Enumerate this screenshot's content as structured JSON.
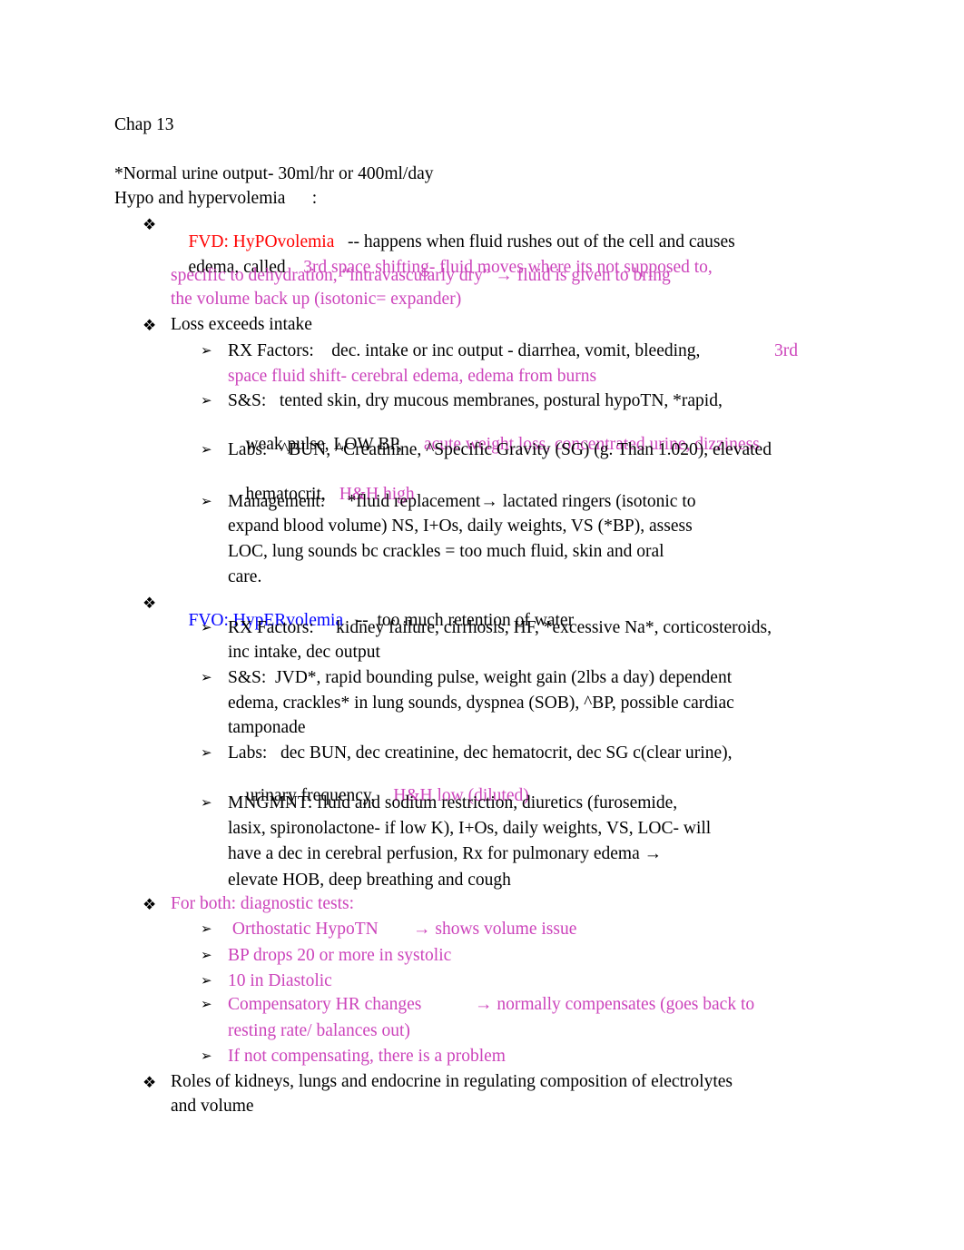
{
  "colors": {
    "red": "#ff0000",
    "blue": "#0000ff",
    "pink": "#cc44bb",
    "text": "#000000"
  },
  "icons": {
    "level1_bullet": "❖",
    "level2_bullet": "➢"
  },
  "heading": "Chap 13",
  "intro": {
    "urine": "*Normal urine output- 30ml/hr or 400ml/day",
    "topic": "Hypo and hypervolemia      :"
  },
  "fvd": {
    "title": "FVD: HyPOvolemia",
    "desc_black_1": "   -- happens when fluid rushes out of the cell and causes",
    "desc_black_2": "edema, called ",
    "desc_pink_2": "   3rd space shifting- fluid moves where its not supposed to,",
    "desc_pink_3": "specific to dehydration, “intravascularly dry” → fluid is given to bring",
    "desc_pink_4": "the volume back up (isotonic= expander)"
  },
  "loss": {
    "title": "Loss exceeds intake",
    "rx_1": "RX Factors:    dec. intake or inc output - diarrhea, vomit, bleeding,",
    "rx_1_pink": "3rd",
    "rx_2_pink": "space fluid shift- cerebral edema, edema from burns",
    "ss_1": "S&S:   tented skin, dry mucous membranes, postural hypoTN, *rapid,",
    "ss_2": "weak pulse, LOW BP,",
    "ss_2_pink": "acute weight loss, concentrated urine, dizziness",
    "labs_1": "Labs:   ^BUN, ^Creatinine, ^Specific Gravity (SG) (g. Than 1.020), elevated",
    "labs_2": "hematocrit,",
    "labs_2_pink": "H&H high",
    "mgmt_1": "Management:     *fluid replacement→ lactated ringers (isotonic to",
    "mgmt_2": "expand blood volume) NS, I+Os, daily weights, VS (*BP), assess",
    "mgmt_3": "LOC, lung sounds bc crackles = too much fluid, skin and oral",
    "mgmt_4": "care."
  },
  "fvo": {
    "title": "FVO: HypERvolemia",
    "desc": "   --  too much retention of water",
    "rx_1": "RX Factors:     kidney failure, cirrhosis, HF, *excessive Na*, corticosteroids,",
    "rx_2": "inc intake, dec output",
    "ss_1": "S&S:  JVD*, rapid bounding pulse, weight gain (2lbs a day) dependent",
    "ss_2": "edema, crackles* in lung sounds, dyspnea (SOB), ^BP, possible cardiac",
    "ss_3": "tamponade",
    "labs_1": "Labs:   dec BUN, dec creatinine, dec hematocrit, dec SG c(clear urine),",
    "labs_2": "urinary frequency,",
    "labs_2_pink": "H&H low (diluted)",
    "mgmt_1": "MNGMNT: fluid and sodium restriction, diuretics (furosemide,",
    "mgmt_2": "lasix, spironolactone- if low K), I+Os, daily weights, VS, LOC- will",
    "mgmt_3": "have a dec in cerebral perfusion, Rx for pulmonary edema →",
    "mgmt_4": "elevate HOB, deep breathing and cough"
  },
  "both": {
    "title": "For both: diagnostic tests:",
    "items": [
      {
        "a": " Orthostatic HypoTN",
        "b": "→ shows volume issue"
      },
      {
        "a": "BP drops 20 or more in systolic"
      },
      {
        "a": "10 in Diastolic"
      },
      {
        "a": "Compensatory HR changes",
        "b": "→ normally compensates (goes back to",
        "c": "resting rate/ balances out)"
      },
      {
        "a": "If not compensating, there is a problem"
      }
    ]
  },
  "roles": {
    "line_1": "Roles of kidneys, lungs and endocrine in regulating composition of electrolytes",
    "line_2": "and volume"
  }
}
